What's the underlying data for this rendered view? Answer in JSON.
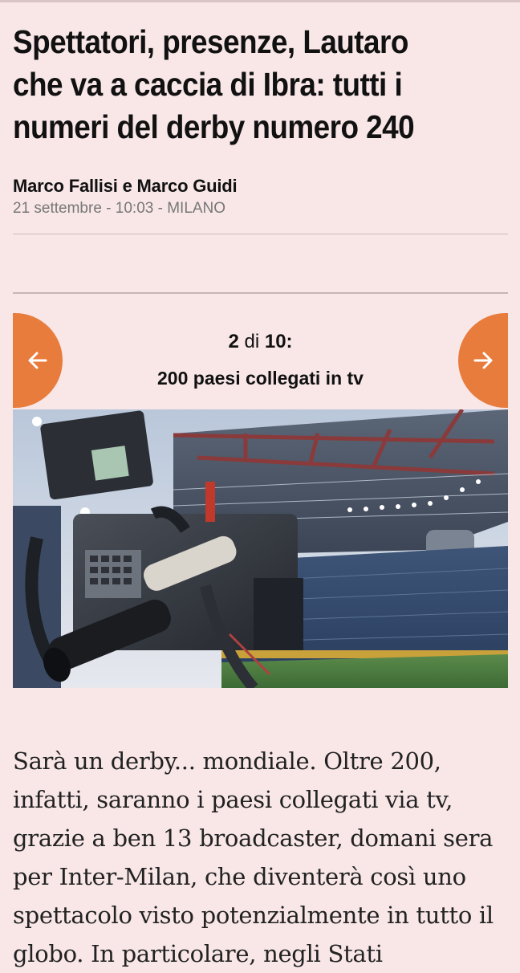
{
  "article": {
    "headline": "Spettatori, presenze, Lautaro che va a caccia di Ibra: tutti i numeri del derby numero 240",
    "author": "Marco Fallisi e Marco Guidi",
    "dateline": "21 settembre - 10:03 - MILANO"
  },
  "gallery": {
    "current": "2",
    "separator": "di",
    "total": "10:",
    "caption_title": "200 paesi collegati in tv",
    "prev_icon": "arrow-left-icon",
    "next_icon": "arrow-right-icon",
    "accent_color": "#e87c3c"
  },
  "photo": {
    "subject": "tv-camera-in-stadium"
  },
  "body": {
    "text": "Sarà un derby... mondiale. Oltre 200, infatti, saranno i paesi collegati via tv, grazie a ben 13 broadcaster, domani sera per Inter-Milan, che diventerà così uno spettacolo visto potenzialmente in tutto il globo. In particolare, negli Stati"
  },
  "colors": {
    "background": "#f9e7e8",
    "accent": "#e87c3c"
  }
}
